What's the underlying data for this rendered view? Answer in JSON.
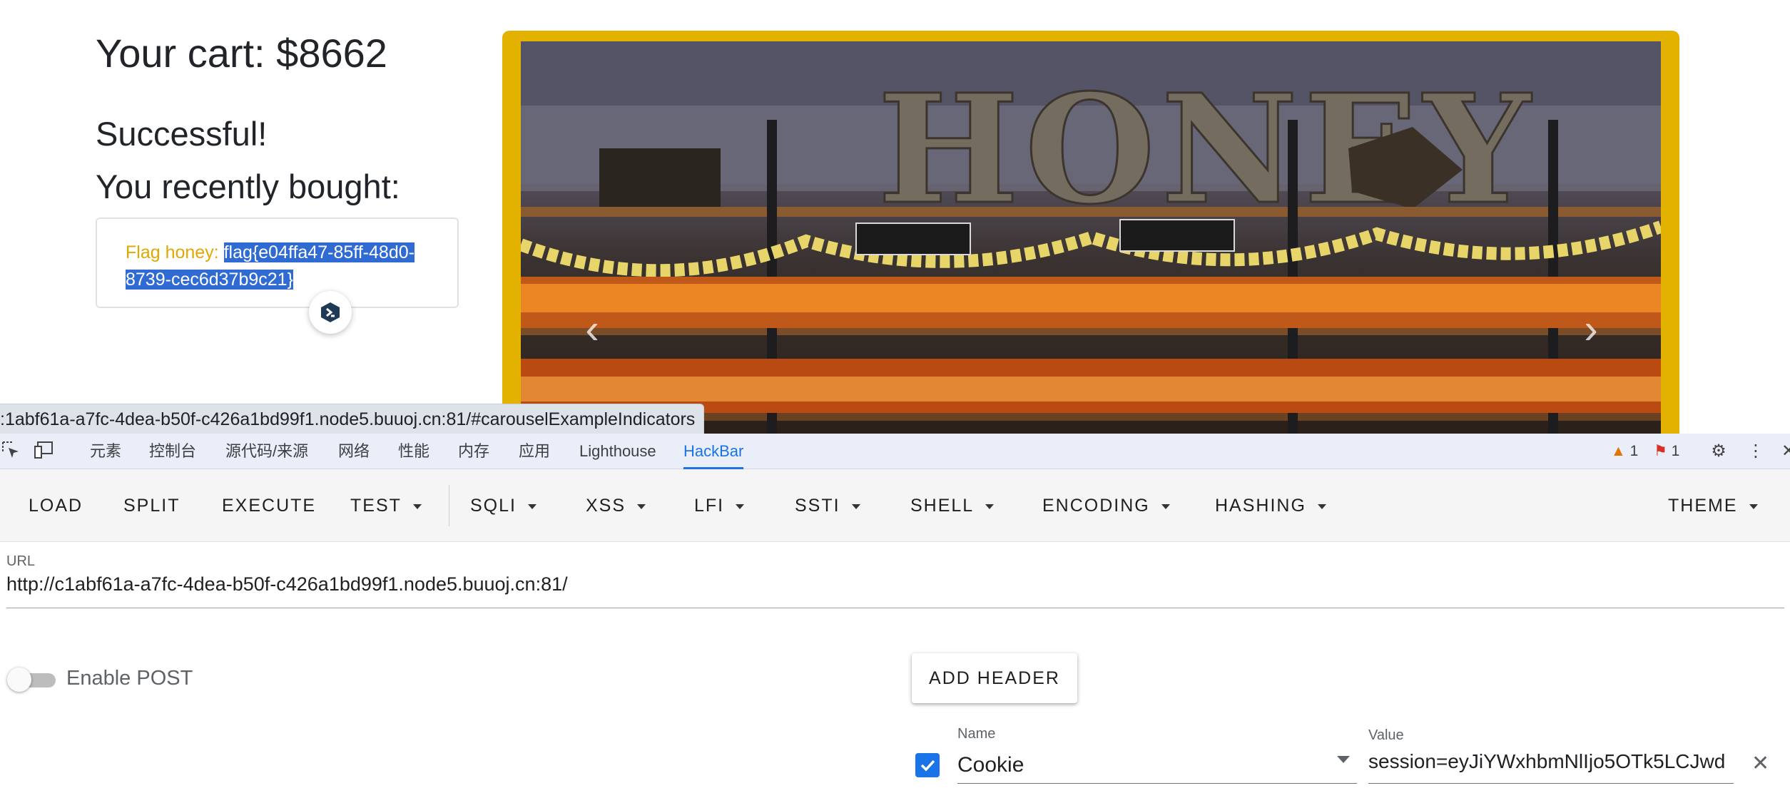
{
  "page": {
    "cart_title": "Your cart: $8662",
    "success": "Successful!",
    "recently_bought": "You recently bought:",
    "purchase_label": "Flag honey:",
    "purchase_flag": "flag{e04ffa47-85ff-48d0-8739-cec6d37b9c21}",
    "carousel_image": "honey-shop-shelves",
    "status_url": ":1abf61a-a7fc-4dea-b50f-c426a1bd99f1.node5.buuoj.cn:81/#carouselExampleIndicators"
  },
  "devtools": {
    "tabs": [
      "元素",
      "控制台",
      "源代码/来源",
      "网络",
      "性能",
      "内存",
      "应用",
      "Lighthouse",
      "HackBar"
    ],
    "active_tab": "HackBar",
    "warnings_count": "1",
    "issues_count": "1"
  },
  "hackbar": {
    "toolbar": {
      "load": "LOAD",
      "split": "SPLIT",
      "execute": "EXECUTE",
      "test": "TEST",
      "sqli": "SQLI",
      "xss": "XSS",
      "lfi": "LFI",
      "ssti": "SSTI",
      "shell": "SHELL",
      "encoding": "ENCODING",
      "hashing": "HASHING",
      "theme": "THEME"
    },
    "url_label": "URL",
    "url_value": "http://c1abf61a-a7fc-4dea-b50f-c426a1bd99f1.node5.buuoj.cn:81/",
    "enable_post_label": "Enable POST",
    "enable_post": false,
    "add_header_label": "ADD HEADER",
    "header_row": {
      "checked": true,
      "name_label": "Name",
      "name_value": "Cookie",
      "value_label": "Value",
      "value_value": "session=eyJiYWxhbmNlIjo5OTk5LCJwd"
    }
  },
  "colors": {
    "accent": "#1a73e8",
    "carousel_frame": "#e3b100",
    "flag_label": "#e0a800",
    "selection": "#2f6bd2"
  }
}
